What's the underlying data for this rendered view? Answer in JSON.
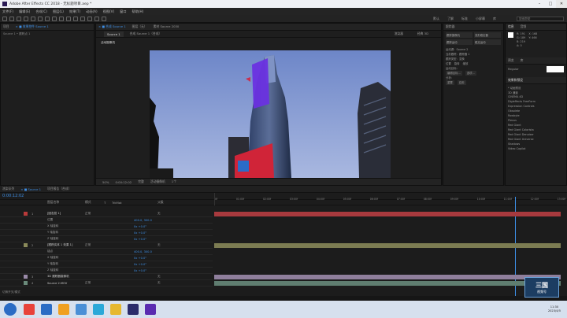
{
  "window": {
    "title": "Adobe After Effects CC 2018 - 无标题项目.aep *",
    "min": "–",
    "max": "□",
    "close": "✕"
  },
  "menu": [
    "文件(F)",
    "编辑(E)",
    "合成(C)",
    "图层(L)",
    "效果(T)",
    "动画(A)",
    "视图(V)",
    "窗口",
    "帮助(H)"
  ],
  "workspace": {
    "items": [
      "默认",
      "了解",
      "标准",
      "小屏幕",
      "库"
    ],
    "search": "搜索帮助"
  },
  "project_panel": {
    "tabs": [
      "项目",
      "× ■ 效果控件 Source 1"
    ],
    "source_label": "Source 1 • 跟踪点 1"
  },
  "comp_panel": {
    "tabs": [
      "× ■ 合成 Source 1",
      "图层（无）",
      "素材 Source 2030"
    ],
    "subtab": "Source 1",
    "subtab2": "合成 Source 1（合成）",
    "label_tl": "活动摄像机",
    "label_renderer": "渲染器",
    "label_classic": "经典 3D",
    "zoom": "50%",
    "quality": "完整",
    "camera": "活动摄像机",
    "views": "1个",
    "time": "0:00:12:02"
  },
  "tracker_panel": {
    "title": "跟踪器",
    "items": [
      "跟踪摄像机",
      "变形稳定器",
      "跟踪运动",
      "稳定运动"
    ],
    "motion_source": "运动源：Source 2",
    "current_track": "当前跟踪：跟踪器 1",
    "track_type": "跟踪类型：变换",
    "options": [
      "位置",
      "旋转",
      "缩放"
    ],
    "target": "运动目标：",
    "edit_target": "编辑目标...",
    "options_btn": "选项...",
    "analyze": "分析：",
    "reset": "重置",
    "apply": "应用"
  },
  "info_panel": {
    "tabs": [
      "信息",
      "音频"
    ],
    "r": "R:",
    "g": "G:",
    "b": "B:",
    "a": "A: 0",
    "x": "X: 168",
    "y": "Y: 466",
    "rgb_vals": [
      "R: 191",
      "G: 189",
      "B: 219"
    ],
    "preview": "预览",
    "lib": "库",
    "props": "属性",
    "project_search": "Regular"
  },
  "effects_panel": {
    "title": "效果和预设",
    "items": [
      "* 动画预设",
      "3D 通道",
      "CINEMA 4D",
      "Digieffects FreeForm",
      "Expression Controls",
      "Obsolete",
      "Rowbyte",
      "Plexus",
      "Red Giant",
      "Red Giant Colorista",
      "Red Giant Denoiser",
      "Red Giant Universe",
      "Shadows",
      "Video Copilot"
    ]
  },
  "timeline": {
    "tabs": [
      "渲染队列",
      "× ■ Source 1",
      "项目报告（合成）"
    ],
    "timecode": "0:00:12:02",
    "columns": [
      "图层名称",
      "模式",
      "T",
      "TrkMat",
      "父级"
    ],
    "layers": [
      {
        "num": "1",
        "name": "[固态层 1]",
        "mode": "正常",
        "parent": "无",
        "color": "#b93a3a"
      },
      {
        "num": "",
        "name": "位置",
        "mode": "",
        "parent": "400.0, 300.0",
        "color": "#444"
      },
      {
        "num": "",
        "name": "X 轴旋转",
        "mode": "",
        "parent": "0x +0.0°",
        "color": "#444"
      },
      {
        "num": "",
        "name": "Y 轴旋转",
        "mode": "",
        "parent": "0x +0.0°",
        "color": "#444"
      },
      {
        "num": "",
        "name": "Z 轴旋转",
        "mode": "",
        "parent": "0x +0.0°",
        "color": "#444"
      },
      {
        "num": "2",
        "name": "[跟踪实体 1 效果 1]",
        "mode": "正常",
        "parent": "无",
        "color": "#8a8a5a"
      },
      {
        "num": "",
        "name": "锚点",
        "mode": "",
        "parent": "400.0, 300.0",
        "color": "#444"
      },
      {
        "num": "",
        "name": "X 轴旋转",
        "mode": "",
        "parent": "0x +0.0°",
        "color": "#444"
      },
      {
        "num": "",
        "name": "Y 轴旋转",
        "mode": "",
        "parent": "0x +0.0°",
        "color": "#444"
      },
      {
        "num": "",
        "name": "Z 轴旋转",
        "mode": "",
        "parent": "0x +0.0°",
        "color": "#444"
      },
      {
        "num": "3",
        "name": "3D 跟踪器摄像机",
        "mode": "",
        "parent": "无",
        "color": "#9a8aa8"
      },
      {
        "num": "4",
        "name": "Source 2.MOV",
        "mode": "正常",
        "parent": "无",
        "color": "#6a8a7a"
      }
    ],
    "ruler": [
      "0f",
      "01:00f",
      "02:00f",
      "03:00f",
      "04:00f",
      "05:00f",
      "06:00f",
      "07:00f",
      "08:00f",
      "09:00f",
      "10:00f",
      "11:00f",
      "12:00f",
      "13:00f"
    ],
    "footer": "切换开关/模式"
  },
  "watermark": "三国",
  "watermark_sub": "视频号",
  "taskbar": {
    "time": "11:30",
    "date": "2023/4/5"
  }
}
